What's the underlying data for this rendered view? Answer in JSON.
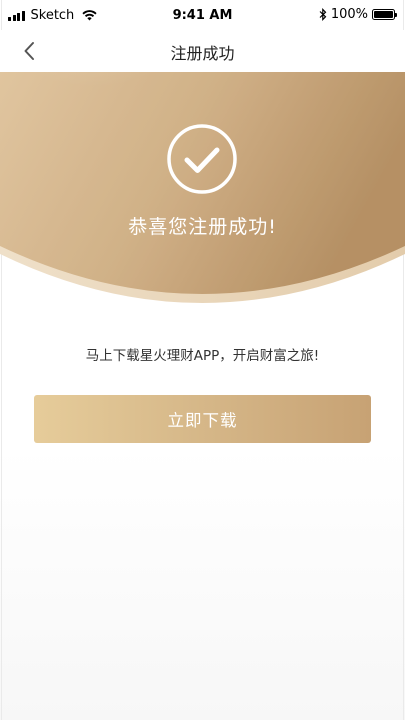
{
  "status_bar": {
    "carrier": "Sketch",
    "time": "9:41 AM",
    "battery": "100%"
  },
  "nav": {
    "title": "注册成功"
  },
  "hero": {
    "message": "恭喜您注册成功!"
  },
  "description": "马上下载星火理财APP，开启财富之旅!",
  "download_button": {
    "label": "立即下载"
  },
  "colors": {
    "gold_light": "#e6cc9a",
    "gold_dark": "#b98f5f",
    "text": "#333333"
  },
  "icons": {
    "back": "chevron-left-icon",
    "success": "check-circle-icon",
    "wifi": "wifi-icon",
    "bluetooth": "bluetooth-icon",
    "signal": "signal-icon",
    "battery": "battery-icon"
  }
}
